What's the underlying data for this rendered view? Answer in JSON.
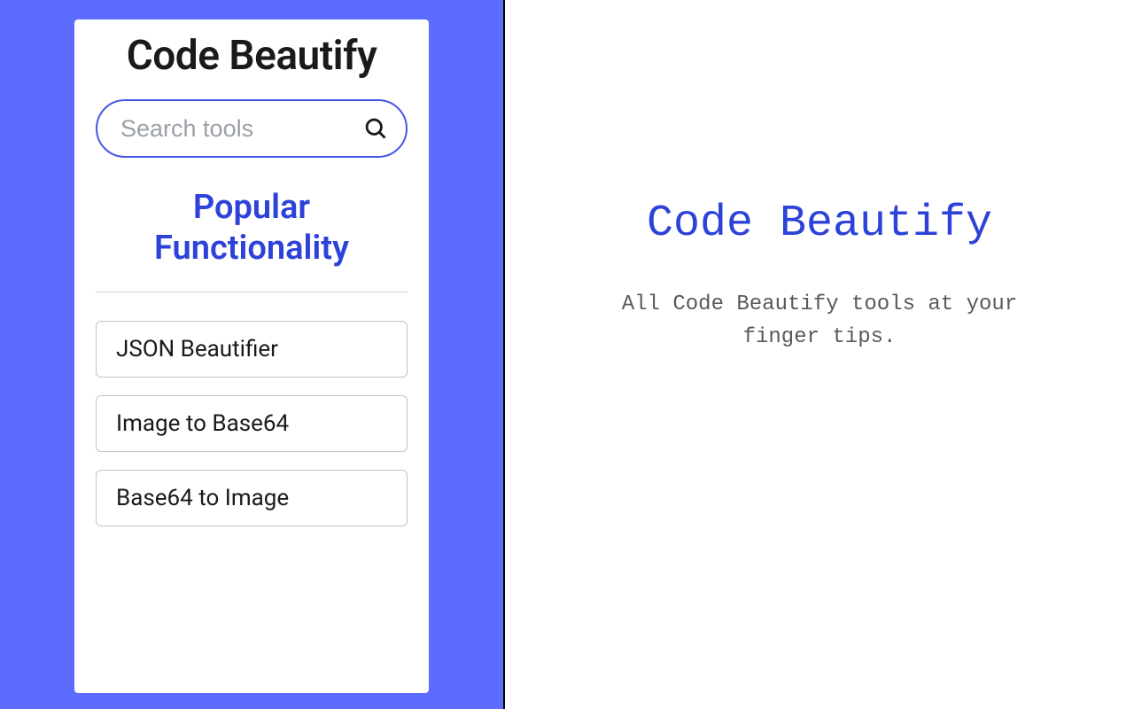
{
  "left": {
    "app_title": "Code Beautify",
    "search": {
      "placeholder": "Search tools"
    },
    "section_heading": "Popular Functionality",
    "tools": [
      {
        "label": "JSON Beautifier"
      },
      {
        "label": "Image to Base64"
      },
      {
        "label": "Base64 to Image"
      }
    ]
  },
  "right": {
    "title": "Code Beautify",
    "subtitle": "All Code Beautify tools at your finger tips."
  }
}
